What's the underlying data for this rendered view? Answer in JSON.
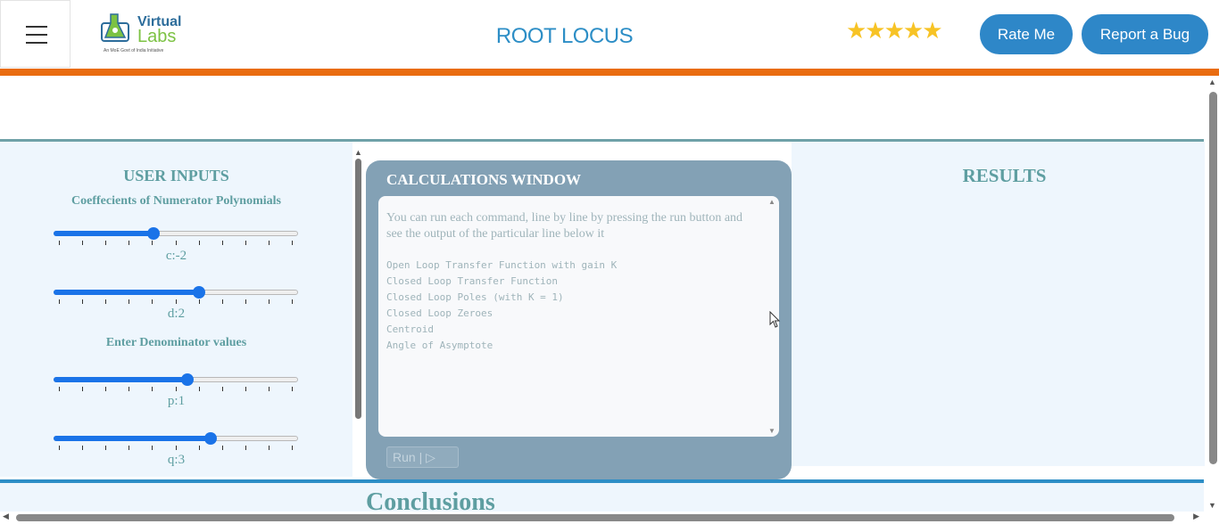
{
  "header": {
    "logo": {
      "line1": "Virtual",
      "line2": "Labs",
      "tagline": "An MoE Govt of India Initiative"
    },
    "title": "ROOT LOCUS",
    "rating_stars": "★★★★★",
    "rating_value": 4.5,
    "rate_button": "Rate Me",
    "bug_button": "Report a Bug"
  },
  "user_inputs": {
    "title": "USER INPUTS",
    "numerator_heading": "Coeffecients of Numerator Polynomials",
    "denominator_heading": "Enter Denominator values",
    "sliders": [
      {
        "name": "c",
        "label": "c:-2",
        "fraction": 0.41
      },
      {
        "name": "d",
        "label": "d:2",
        "fraction": 0.595
      },
      {
        "name": "p",
        "label": "p:1",
        "fraction": 0.547
      },
      {
        "name": "q",
        "label": "q:3",
        "fraction": 0.642
      }
    ]
  },
  "calculations": {
    "title": "CALCULATIONS WINDOW",
    "description": "You can run each command, line by line by pressing the run button and see the output of the particular line below it",
    "commands": [
      "Open Loop Transfer Function with gain K",
      "Closed Loop Transfer Function",
      "Closed Loop Poles (with K = 1)",
      "Closed Loop Zeroes",
      "Centroid",
      "Angle of Asymptote"
    ],
    "run_button": "Run | ▷"
  },
  "results": {
    "title": "RESULTS"
  },
  "conclusions": {
    "title": "Conclusions"
  },
  "colors": {
    "accent_blue": "#2e87c8",
    "orange_bar": "#e96c10",
    "teal_text": "#5e9ea1",
    "calc_panel": "#83a1b5",
    "slider_blue": "#1a73e8"
  }
}
